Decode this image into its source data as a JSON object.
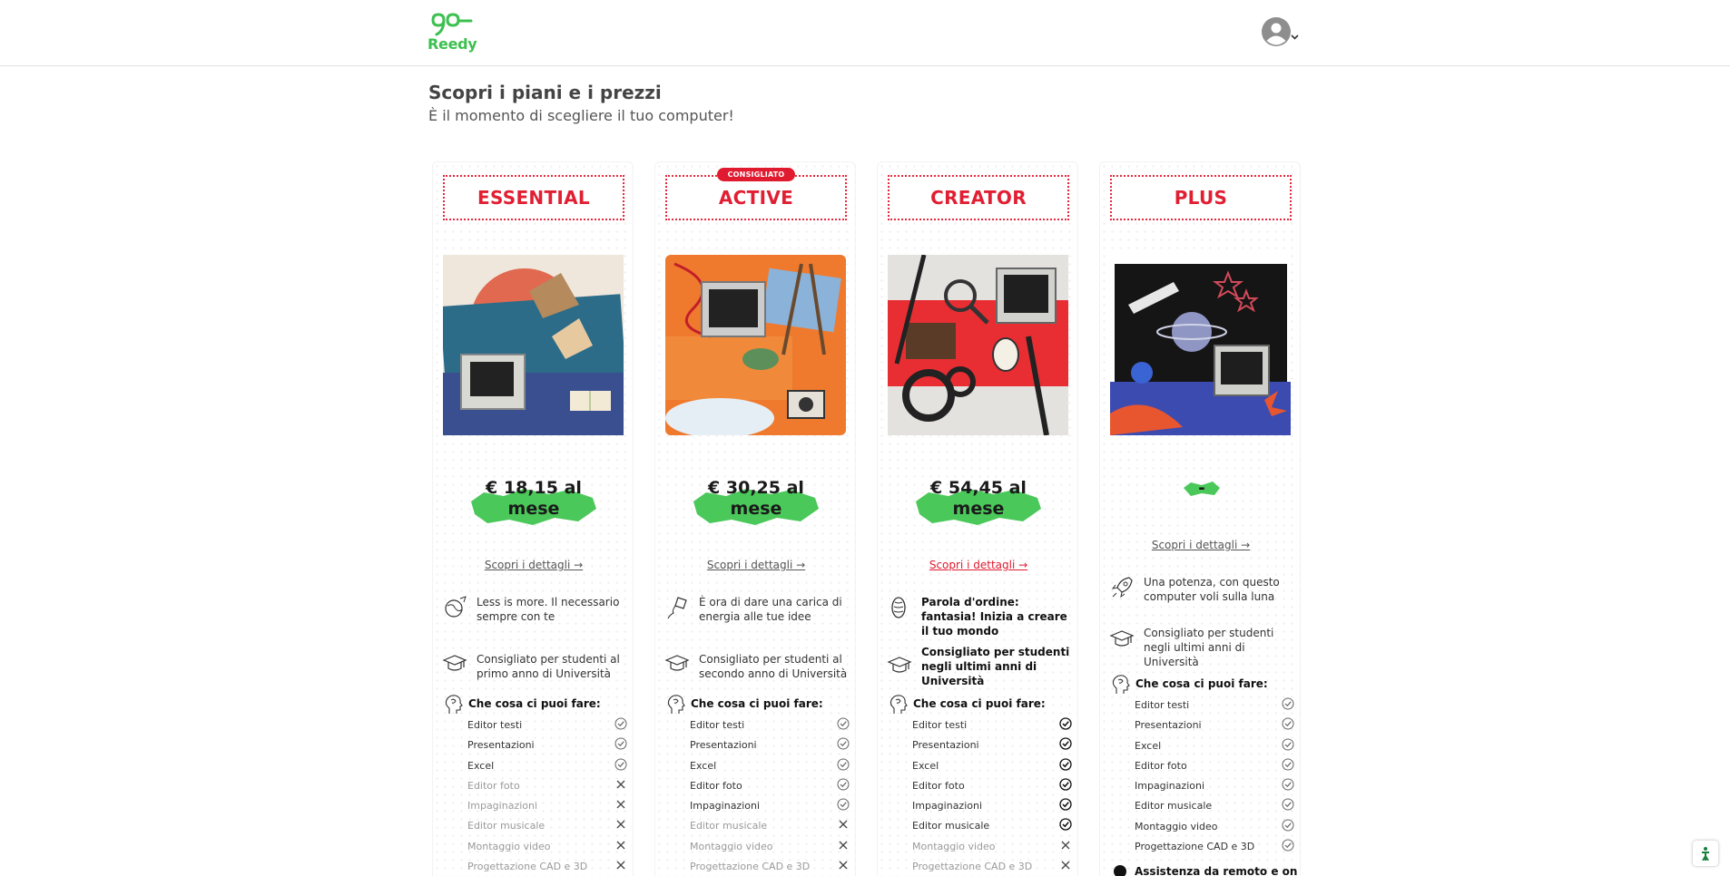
{
  "brand": {
    "name": "Reedy",
    "color": "#3cc04f"
  },
  "accent_red": "#e01a2f",
  "header": {
    "avatar_icon": "user-circle-icon",
    "menu_icon": "chevron-down-icon"
  },
  "page": {
    "title": "Scopri i piani e i prezzi",
    "subtitle": "È il momento di scegliere il tuo computer!"
  },
  "plans": [
    {
      "name": "ESSENTIAL",
      "badge": "",
      "price": "€ 18,15 al mese",
      "details": "Scopri i dettagli →",
      "tagline": "Less is more. Il necessario sempre con te",
      "tagline_icon": "globe-doodle-icon",
      "audience": "Consigliato per studenti al primo anno di Università",
      "audience_icon": "graduation-cap-icon",
      "can_do_title": "Che cosa ci puoi fare:",
      "features": [
        {
          "label": "Editor testi",
          "available": true
        },
        {
          "label": "Presentazioni",
          "available": true
        },
        {
          "label": "Excel",
          "available": true
        },
        {
          "label": "Editor foto",
          "available": false
        },
        {
          "label": "Impaginazioni",
          "available": false
        },
        {
          "label": "Editor musicale",
          "available": false
        },
        {
          "label": "Montaggio video",
          "available": false
        },
        {
          "label": "Progettazione CAD e 3D",
          "available": false
        }
      ]
    },
    {
      "name": "ACTIVE",
      "badge": "CONSIGLIATO",
      "price": "€ 30,25 al mese",
      "details": "Scopri i dettagli →",
      "tagline": "È ora di dare una carica di energia alle tue idee",
      "tagline_icon": "kite-icon",
      "audience": "Consigliato per studenti al secondo anno di Università",
      "audience_icon": "graduation-cap-icon",
      "can_do_title": "Che cosa ci puoi fare:",
      "features": [
        {
          "label": "Editor testi",
          "available": true
        },
        {
          "label": "Presentazioni",
          "available": true
        },
        {
          "label": "Excel",
          "available": true
        },
        {
          "label": "Editor foto",
          "available": true
        },
        {
          "label": "Impaginazioni",
          "available": true
        },
        {
          "label": "Editor musicale",
          "available": false
        },
        {
          "label": "Montaggio video",
          "available": false
        },
        {
          "label": "Progettazione CAD e 3D",
          "available": false
        }
      ]
    },
    {
      "name": "CREATOR",
      "badge": "",
      "price": "€ 54,45 al mese",
      "details": "Scopri i dettagli →",
      "tagline": "Parola d'ordine: fantasia! Inizia a creare il tuo mondo",
      "tagline_icon": "brain-icon",
      "audience": "Consigliato per studenti negli ultimi anni di Università",
      "audience_icon": "graduation-cap-icon",
      "can_do_title": "Che cosa ci puoi fare:",
      "features": [
        {
          "label": "Editor testi",
          "available": true
        },
        {
          "label": "Presentazioni",
          "available": true
        },
        {
          "label": "Excel",
          "available": true
        },
        {
          "label": "Editor foto",
          "available": true
        },
        {
          "label": "Impaginazioni",
          "available": true
        },
        {
          "label": "Editor musicale",
          "available": true
        },
        {
          "label": "Montaggio video",
          "available": false
        },
        {
          "label": "Progettazione CAD e 3D",
          "available": false
        }
      ]
    },
    {
      "name": "PLUS",
      "badge": "",
      "price": "-",
      "details": "Scopri i dettagli →",
      "tagline": "Una potenza, con questo computer voli sulla luna",
      "tagline_icon": "rocket-icon",
      "audience": "Consigliato per studenti negli ultimi anni di Università",
      "audience_icon": "graduation-cap-icon",
      "can_do_title": "Che cosa ci puoi fare:",
      "features": [
        {
          "label": "Editor testi",
          "available": true
        },
        {
          "label": "Presentazioni",
          "available": true
        },
        {
          "label": "Excel",
          "available": true
        },
        {
          "label": "Editor foto",
          "available": true
        },
        {
          "label": "Impaginazioni",
          "available": true
        },
        {
          "label": "Editor musicale",
          "available": true
        },
        {
          "label": "Montaggio video",
          "available": true
        },
        {
          "label": "Progettazione CAD e 3D",
          "available": true
        }
      ],
      "extra": "Assistenza da remoto e on"
    }
  ]
}
